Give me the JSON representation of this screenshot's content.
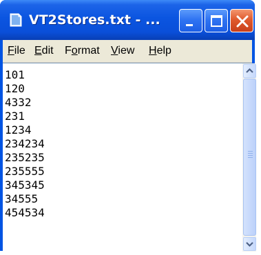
{
  "window": {
    "title": "VT2Stores.txt - ...",
    "icon": "notepad-icon"
  },
  "title_buttons": {
    "minimize_icon": "minimize-icon",
    "maximize_icon": "maximize-icon",
    "close_icon": "close-icon"
  },
  "menu": {
    "items": [
      {
        "label": "File",
        "mnemonic": "F",
        "rest": "ile"
      },
      {
        "label": "Edit",
        "mnemonic": "E",
        "rest": "dit"
      },
      {
        "label": "Format",
        "prefix": "F",
        "mnemonic": "o",
        "rest": "rmat"
      },
      {
        "label": "View",
        "mnemonic": "V",
        "rest": "iew"
      },
      {
        "label": "Help",
        "mnemonic": "H",
        "rest": "elp"
      }
    ]
  },
  "document": {
    "lines": [
      "101",
      "120",
      "4332",
      "231",
      "1234",
      "234234",
      "235235",
      "235555",
      "345345",
      "34555",
      "454534"
    ]
  },
  "scrollbar": {
    "up_icon": "scroll-up-arrow-icon",
    "down_icon": "scroll-down-arrow-icon"
  },
  "colors": {
    "titlebar": "#0b55e0",
    "close_button": "#e05a2d",
    "menubar": "#ece9d8"
  }
}
